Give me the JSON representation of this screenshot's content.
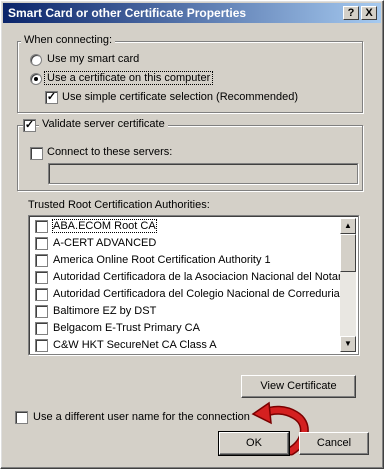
{
  "window": {
    "title": "Smart Card or other Certificate Properties",
    "help_glyph": "?",
    "close_glyph": "X"
  },
  "connecting": {
    "legend": "When connecting:",
    "options": [
      {
        "label": "Use my smart card",
        "selected": false
      },
      {
        "label": "Use a certificate on this computer",
        "selected": true
      }
    ],
    "simple_selection": {
      "label": "Use simple certificate selection (Recommended)",
      "checked": true
    }
  },
  "validate": {
    "label": "Validate server certificate",
    "checked": true,
    "connect_servers": {
      "label": "Connect to these servers:",
      "checked": false,
      "value": ""
    }
  },
  "trusted_roots": {
    "label": "Trusted Root Certification Authorities:",
    "items": [
      {
        "label": "ABA.ECOM Root CA",
        "checked": false
      },
      {
        "label": "A-CERT ADVANCED",
        "checked": false
      },
      {
        "label": "America Online Root Certification Authority 1",
        "checked": false
      },
      {
        "label": "Autoridad Certificadora de la Asociacion Nacional del Notariad",
        "checked": false
      },
      {
        "label": "Autoridad Certificadora del Colegio Nacional de Correduria Pu",
        "checked": false
      },
      {
        "label": "Baltimore EZ by DST",
        "checked": false
      },
      {
        "label": "Belgacom E-Trust Primary CA",
        "checked": false
      },
      {
        "label": "C&W HKT SecureNet CA Class A",
        "checked": false
      }
    ]
  },
  "buttons": {
    "view_certificate": "View Certificate",
    "ok": "OK",
    "cancel": "Cancel"
  },
  "different_user": {
    "label": "Use a different user name for the connection",
    "checked": false
  },
  "icons": {
    "arrow": "red-curved-arrow-icon"
  },
  "colors": {
    "title_start": "#0a246a",
    "title_end": "#a6caf0",
    "arrow": "#d42020",
    "face": "#d4d0c8"
  }
}
